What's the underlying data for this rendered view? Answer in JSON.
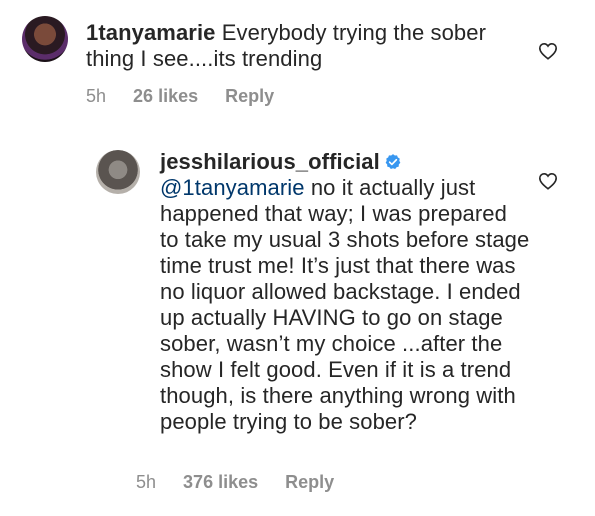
{
  "comments": [
    {
      "username": "1tanyamarie",
      "text": "Everybody trying the sober thing I see....its trending",
      "time": "5h",
      "likes": "26 likes",
      "reply": "Reply"
    },
    {
      "username": "jesshilarious_official",
      "mention": "@1tanyamarie",
      "text": " no it actually just happened that way; I was prepared to take my usual 3 shots before stage time trust me! It’s just that there was no liquor allowed backstage. I ended up actually HAVING to go on stage sober, wasn’t my choice ...after the show I felt good. Even if it is a trend though, is there anything wrong with people trying to be sober?",
      "time": "5h",
      "likes": "376 likes",
      "reply": "Reply"
    }
  ],
  "icons": {
    "like": "heart-icon",
    "verified": "verified-badge-icon"
  },
  "colors": {
    "mention": "#00376b",
    "meta": "#8e8e8e",
    "verified": "#3897f0"
  }
}
